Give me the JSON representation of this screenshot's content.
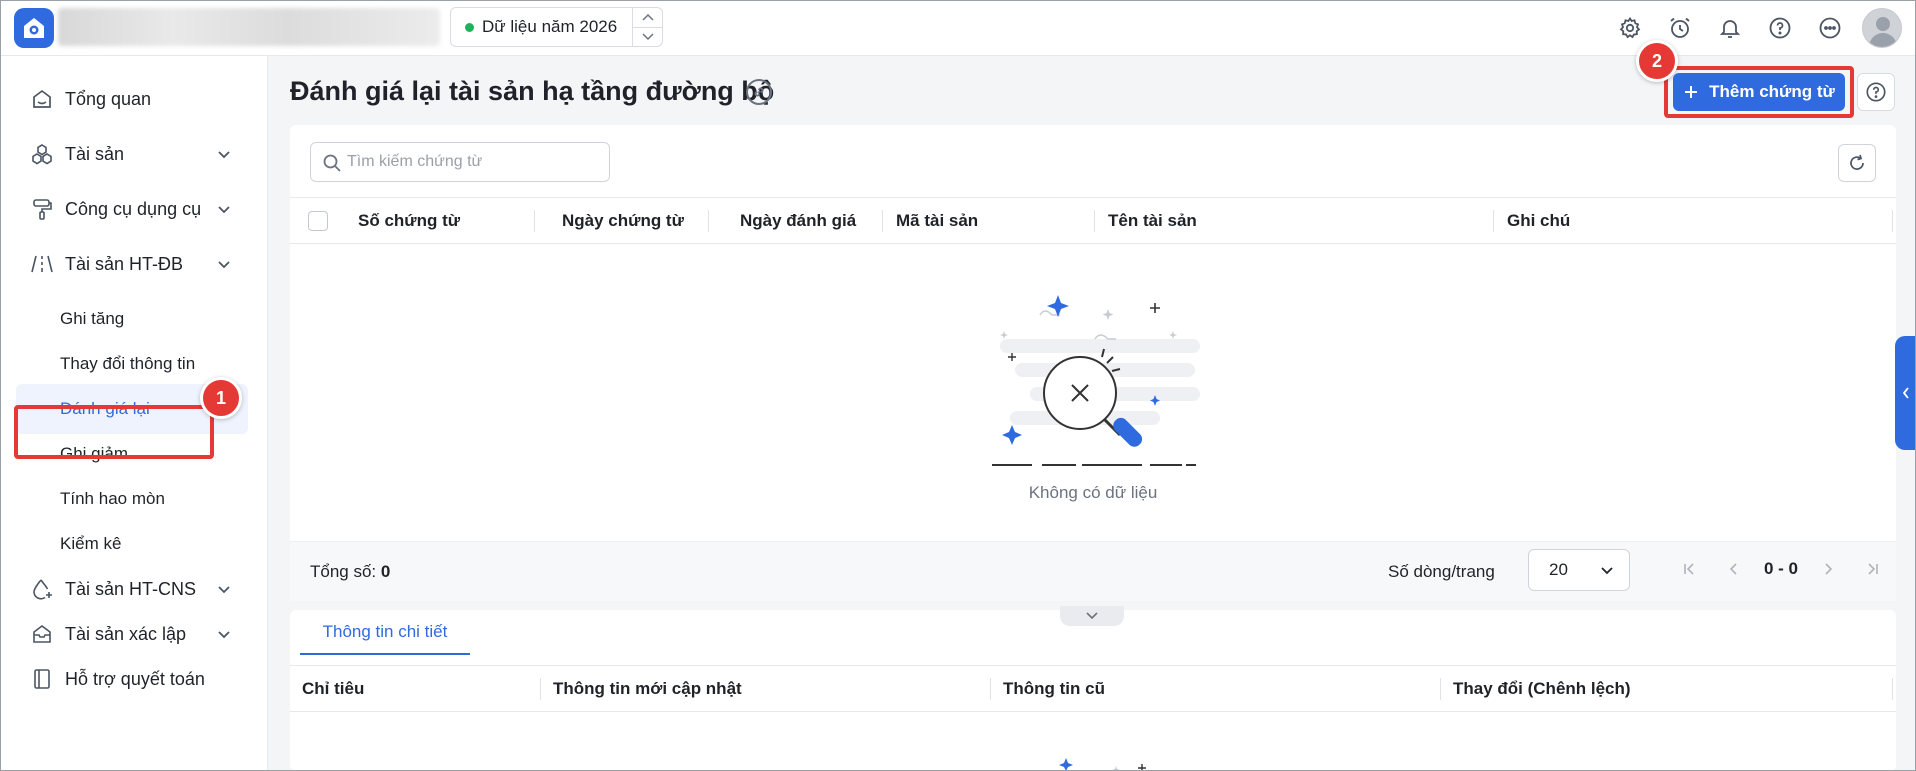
{
  "topbar": {
    "year_label": "Dữ liệu năm 2026",
    "icons": [
      "gear-icon",
      "alarm-clock-icon",
      "bell-icon",
      "help-circle-icon",
      "more-icon",
      "avatar"
    ]
  },
  "sidebar": {
    "items": [
      {
        "label": "Tổng quan",
        "icon": "home-icon"
      },
      {
        "label": "Tài sản",
        "icon": "boxes-icon",
        "expandable": true
      },
      {
        "label": "Công cụ dụng cụ",
        "icon": "paint-roller-icon",
        "expandable": true
      },
      {
        "label": "Tài sản HT-ĐB",
        "icon": "road-icon",
        "expandable": true
      },
      {
        "label": "Tài sản HT-CNS",
        "icon": "water-drop-icon",
        "expandable": true
      },
      {
        "label": "Tài sản xác lập",
        "icon": "inbox-icon",
        "expandable": true
      },
      {
        "label": "Hỗ trợ quyết toán",
        "icon": "book-icon"
      }
    ],
    "subitems": [
      "Ghi tăng",
      "Thay đổi thông tin",
      "Đánh giá lại",
      "Ghi giảm",
      "Tính hao mòn",
      "Kiểm kê"
    ],
    "active_subitem": "Đánh giá lại"
  },
  "annotations": {
    "badge1": "1",
    "badge2": "2",
    "highlight_color": "#e53935"
  },
  "page": {
    "title": "Đánh giá lại tài sản hạ tầng đường bộ",
    "add_button": "Thêm chứng từ",
    "search_placeholder": "Tìm kiếm chứng từ"
  },
  "table": {
    "columns": [
      "Số chứng từ",
      "Ngày chứng từ",
      "Ngày đánh giá",
      "Mã tài sản",
      "Tên tài sản",
      "Ghi chú"
    ],
    "rows": [],
    "empty_text": "Không có dữ liệu",
    "total_label": "Tổng số:",
    "total_value": "0",
    "rows_per_page_label": "Số dòng/trang",
    "rows_per_page": "20",
    "range": "0 - 0"
  },
  "detail": {
    "tab": "Thông tin chi tiết",
    "columns": [
      "Chỉ tiêu",
      "Thông tin mới cập nhật",
      "Thông tin cũ",
      "Thay đổi (Chênh lệch)"
    ]
  },
  "colors": {
    "accent": "#2f6bdf",
    "success_dot": "#1eb35a"
  }
}
